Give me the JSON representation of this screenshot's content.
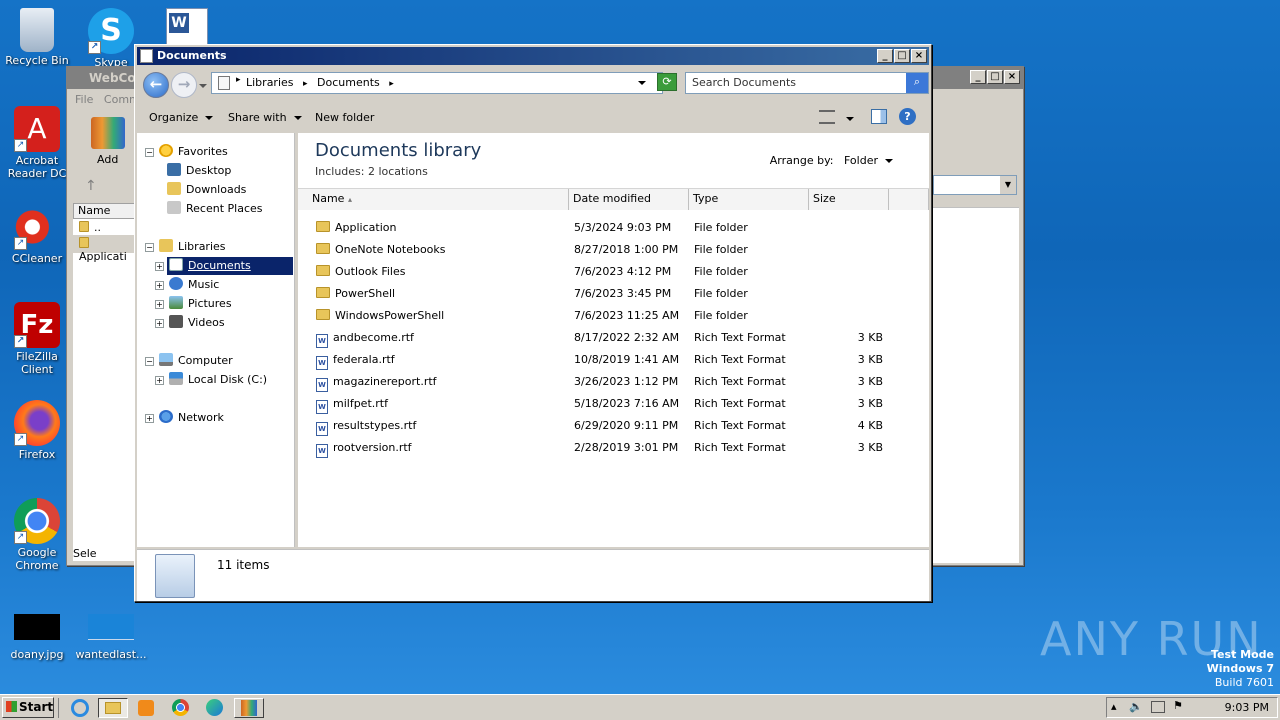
{
  "desktop_icons": [
    {
      "label": "Recycle Bin"
    },
    {
      "label": "Skype"
    },
    {
      "label": "Acrobat Reader DC"
    },
    {
      "label": "CCleaner"
    },
    {
      "label": "FileZilla Client"
    },
    {
      "label": "Firefox"
    },
    {
      "label": "Google Chrome"
    },
    {
      "label": "doany.jpg"
    },
    {
      "label": "wantedlast..."
    }
  ],
  "bg_window": {
    "title": "WebCon",
    "menu_file": "File",
    "menu_comm": "Comm",
    "add_label": "Add",
    "col_name": "Name",
    "row1": "..",
    "row2": "Applicati",
    "status_sel": "Sele"
  },
  "window": {
    "title": "Documents",
    "address": [
      "Libraries",
      "Documents"
    ],
    "search_placeholder": "Search Documents",
    "toolbar": {
      "organize": "Organize",
      "share_with": "Share with",
      "new_folder": "New folder"
    },
    "help": "?"
  },
  "nav_tree": {
    "favorites": "Favorites",
    "desktop": "Desktop",
    "downloads": "Downloads",
    "recent_places": "Recent Places",
    "libraries": "Libraries",
    "documents": "Documents",
    "music": "Music",
    "pictures": "Pictures",
    "videos": "Videos",
    "computer": "Computer",
    "local_disk": "Local Disk (C:)",
    "network": "Network"
  },
  "library": {
    "title": "Documents library",
    "includes": "Includes:  2 locations",
    "arrange_by_label": "Arrange by:",
    "arrange_by_value": "Folder"
  },
  "columns": {
    "name": "Name",
    "date_modified": "Date modified",
    "type": "Type",
    "size": "Size"
  },
  "files": [
    {
      "name": "Application",
      "date": "5/3/2024 9:03 PM",
      "type": "File folder",
      "size": "",
      "kind": "folder"
    },
    {
      "name": "OneNote Notebooks",
      "date": "8/27/2018 1:00 PM",
      "type": "File folder",
      "size": "",
      "kind": "folder"
    },
    {
      "name": "Outlook Files",
      "date": "7/6/2023 4:12 PM",
      "type": "File folder",
      "size": "",
      "kind": "folder"
    },
    {
      "name": "PowerShell",
      "date": "7/6/2023 3:45 PM",
      "type": "File folder",
      "size": "",
      "kind": "folder"
    },
    {
      "name": "WindowsPowerShell",
      "date": "7/6/2023 11:25 AM",
      "type": "File folder",
      "size": "",
      "kind": "folder"
    },
    {
      "name": "andbecome.rtf",
      "date": "8/17/2022 2:32 AM",
      "type": "Rich Text Format",
      "size": "3 KB",
      "kind": "rtf"
    },
    {
      "name": "federala.rtf",
      "date": "10/8/2019 1:41 AM",
      "type": "Rich Text Format",
      "size": "3 KB",
      "kind": "rtf"
    },
    {
      "name": "magazinereport.rtf",
      "date": "3/26/2023 1:12 PM",
      "type": "Rich Text Format",
      "size": "3 KB",
      "kind": "rtf"
    },
    {
      "name": "milfpet.rtf",
      "date": "5/18/2023 7:16 AM",
      "type": "Rich Text Format",
      "size": "3 KB",
      "kind": "rtf"
    },
    {
      "name": "resultstypes.rtf",
      "date": "6/29/2020 9:11 PM",
      "type": "Rich Text Format",
      "size": "4 KB",
      "kind": "rtf"
    },
    {
      "name": "rootversion.rtf",
      "date": "2/28/2019 3:01 PM",
      "type": "Rich Text Format",
      "size": "3 KB",
      "kind": "rtf"
    }
  ],
  "status": {
    "items": "11 items"
  },
  "watermark": {
    "text": "ANY RUN",
    "test_mode": "Test Mode",
    "os": "Windows 7",
    "build": "Build 7601"
  },
  "taskbar": {
    "start": "Start",
    "clock": "9:03 PM"
  },
  "colors": {
    "selection": "#0a246a",
    "title_active": "#0a246a",
    "desktop": "#1573c7"
  }
}
